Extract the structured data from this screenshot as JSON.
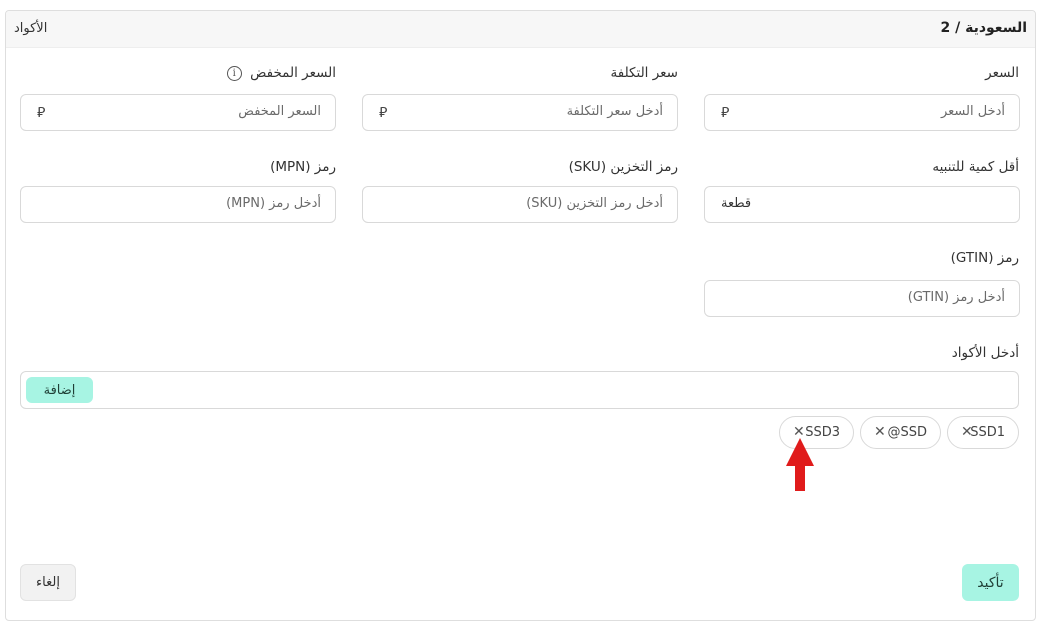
{
  "header": {
    "title": "السعودية / 2",
    "side_label": "الأكواد"
  },
  "currency_icon": "riyal-icon",
  "currency_symbol": "⃁",
  "fields": {
    "price": {
      "label": "السعر",
      "placeholder": "أدخل السعر"
    },
    "cost_price": {
      "label": "سعر التكلفة",
      "placeholder": "أدخل سعر التكلفة"
    },
    "sale_price": {
      "label": "السعر المخفض",
      "placeholder": "السعر المخفض"
    },
    "min_qty_alert": {
      "label": "أقل كمية للتنبيه",
      "unit": "قطعة"
    },
    "sku": {
      "label": "رمز التخزين (SKU)",
      "placeholder": "أدخل رمز التخزين (SKU)"
    },
    "mpn": {
      "label": "رمز (MPN)",
      "placeholder": "أدخل رمز (MPN)"
    },
    "gtin": {
      "label": "رمز (GTIN)",
      "placeholder": "أدخل رمز (GTIN)"
    }
  },
  "codes": {
    "label": "أدخل الأكواد",
    "add_label": "إضافة",
    "chips": [
      "SSD1",
      "@SSD",
      "SSD3"
    ]
  },
  "actions": {
    "confirm_label": "تأكيد",
    "cancel_label": "إلغاء"
  },
  "colors": {
    "accent": "#a7f4e3",
    "arrow": "#e01b1b"
  }
}
